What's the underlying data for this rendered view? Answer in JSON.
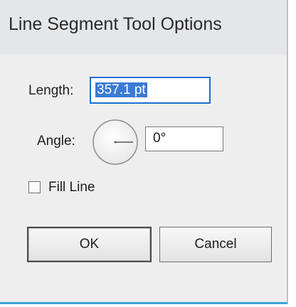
{
  "dialog": {
    "title": "Line Segment Tool Options"
  },
  "length": {
    "label": "Length:",
    "value": "357.1 pt"
  },
  "angle": {
    "label": "Angle:",
    "value": "0°",
    "degrees": 0
  },
  "fill_line": {
    "label": "Fill Line",
    "checked": false
  },
  "buttons": {
    "ok": "OK",
    "cancel": "Cancel"
  },
  "colors": {
    "accent": "#3aa3d6",
    "selection": "#3b7bd6",
    "focus_border": "#1a6fd6"
  }
}
